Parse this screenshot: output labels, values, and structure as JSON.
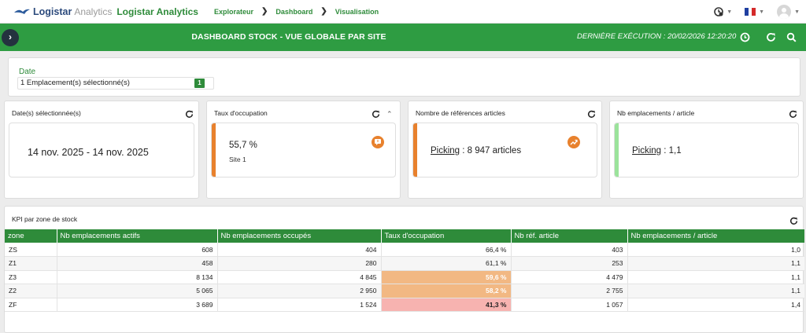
{
  "brand": {
    "logo_name": "Logistar",
    "logo_suffix": "Analytics",
    "app_name": "Logistar Analytics",
    "accent": "#2e9c42"
  },
  "breadcrumb": [
    "Explorateur",
    "Dashboard",
    "Visualisation"
  ],
  "header": {
    "title": "DASHBOARD STOCK - VUE GLOBALE PAR SITE",
    "last_execution": "DERNIÈRE EXÉCUTION : 20/02/2026 12:20:20"
  },
  "filter": {
    "label": "Date",
    "value": "1 Emplacement(s) sélectionné(s)",
    "count": "1"
  },
  "kpis": {
    "dates": {
      "title": "Date(s) sélectionnée(s)",
      "value": "14 nov. 2025 - 14 nov. 2025"
    },
    "occupation": {
      "title": "Taux d'occupation",
      "value": "55,7 %",
      "sub": "Site 1",
      "bar_color": "#e8812d"
    },
    "references": {
      "title": "Nombre de références articles",
      "link": "Picking",
      "value": " : 8 947 articles",
      "bar_color": "#e8812d"
    },
    "per_article": {
      "title": "Nb emplacements / article",
      "link": "Picking",
      "value": " : 1,1",
      "bar_color": "#9be39b"
    }
  },
  "table": {
    "title": "KPI par zone de stock",
    "columns": [
      "zone",
      "Nb emplacements actifs",
      "Nb emplacements occupés",
      "Taux d'occupation",
      "Nb réf. article",
      "Nb emplacements / article"
    ],
    "rows": [
      [
        "ZS",
        "608",
        "404",
        "66,4 %",
        "403",
        "1,0"
      ],
      [
        "Z1",
        "458",
        "280",
        "61,1 %",
        "253",
        "1,1"
      ],
      [
        "Z3",
        "8 134",
        "4 845",
        "59,6 %",
        "4 479",
        "1,1"
      ],
      [
        "Z2",
        "5 065",
        "2 950",
        "58,2 %",
        "2 755",
        "1,1"
      ],
      [
        "ZF",
        "3 689",
        "1 524",
        "41,3 %",
        "1 057",
        "1,4"
      ]
    ],
    "highlight_colors": {
      "orange": "#f2b883",
      "red": "#f7b3b0"
    }
  }
}
